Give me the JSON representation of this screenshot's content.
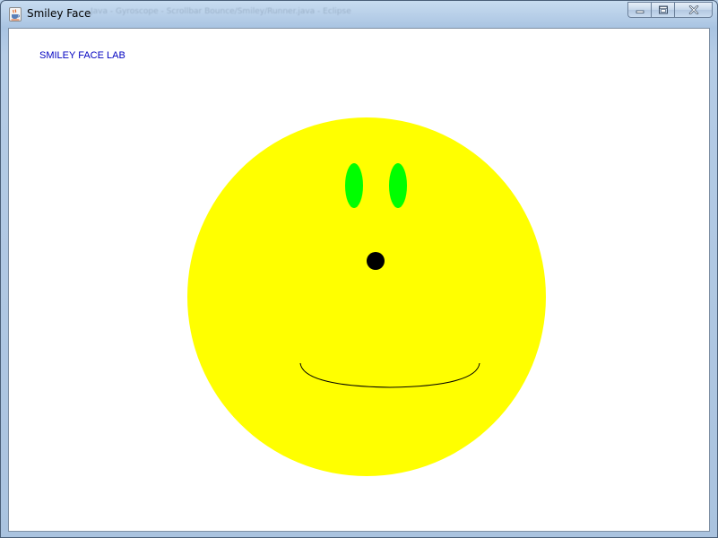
{
  "window": {
    "title": "Smiley Face",
    "background_title": "Java - Gyroscope - Scrollbar Bounce/Smiley/Runner.java - Eclipse"
  },
  "canvas": {
    "label": "SMILEY FACE LAB",
    "label_color": "#0000c0",
    "background_color": "#ffffff"
  },
  "face": {
    "face_color": "#ffff00",
    "eye_color": "#00ff00",
    "nose_color": "#000000",
    "mouth_color": "#000000"
  },
  "icons": {
    "app": "java-coffee-cup-icon",
    "minimize": "minimize-icon",
    "maximize": "maximize-icon",
    "close": "close-icon"
  }
}
